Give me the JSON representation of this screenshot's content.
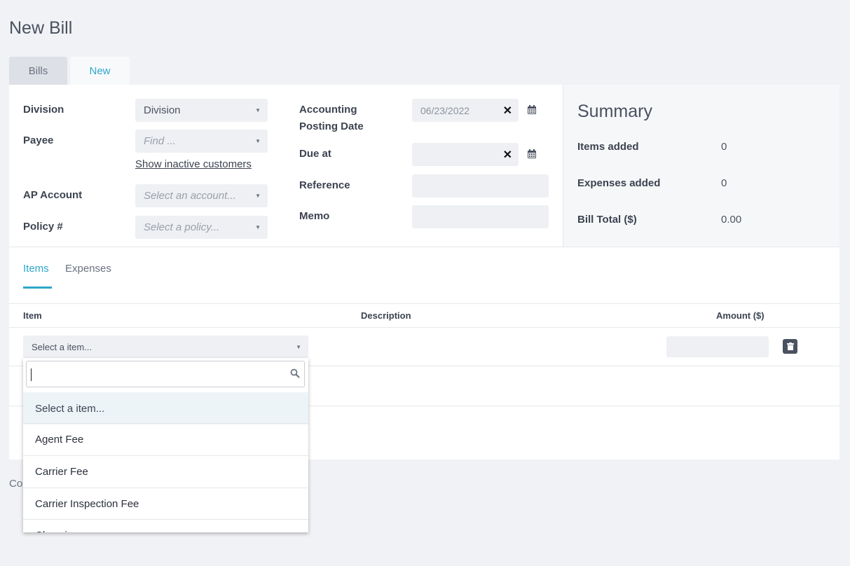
{
  "page": {
    "title": "New Bill"
  },
  "tabs": [
    {
      "label": "Bills"
    },
    {
      "label": "New"
    }
  ],
  "form": {
    "division": {
      "label": "Division",
      "value": "Division"
    },
    "payee": {
      "label": "Payee",
      "placeholder": "Find ..."
    },
    "show_inactive_link": "Show inactive customers",
    "ap_account": {
      "label": "AP Account",
      "placeholder": "Select an account..."
    },
    "policy": {
      "label": "Policy #",
      "placeholder": "Select a policy..."
    },
    "accounting_posting_date": {
      "label_line1": "Accounting",
      "label_line2": "Posting Date",
      "value": "06/23/2022"
    },
    "due_at": {
      "label": "Due at",
      "value": ""
    },
    "reference": {
      "label": "Reference",
      "value": ""
    },
    "memo": {
      "label": "Memo",
      "value": ""
    }
  },
  "summary": {
    "title": "Summary",
    "rows": [
      {
        "label": "Items added",
        "value": "0"
      },
      {
        "label": "Expenses added",
        "value": "0"
      },
      {
        "label": "Bill Total ($)",
        "value": "0.00"
      }
    ]
  },
  "subtabs": [
    {
      "label": "Items"
    },
    {
      "label": "Expenses"
    }
  ],
  "table": {
    "headers": {
      "item": "Item",
      "description": "Description",
      "amount": "Amount ($)"
    },
    "row": {
      "item_placeholder": "Select a item..."
    }
  },
  "footer": {
    "partial_text": "Co"
  },
  "dropdown": {
    "search_value": "",
    "options": [
      "Select a item...",
      "Agent Fee",
      "Carrier Fee",
      "Carrier Inspection Fee",
      "Chassis..."
    ]
  },
  "colors": {
    "accent": "#2ea7c9",
    "field_bg": "#eef0f3",
    "page_bg": "#f1f2f5",
    "dark_button": "#4a5160"
  }
}
